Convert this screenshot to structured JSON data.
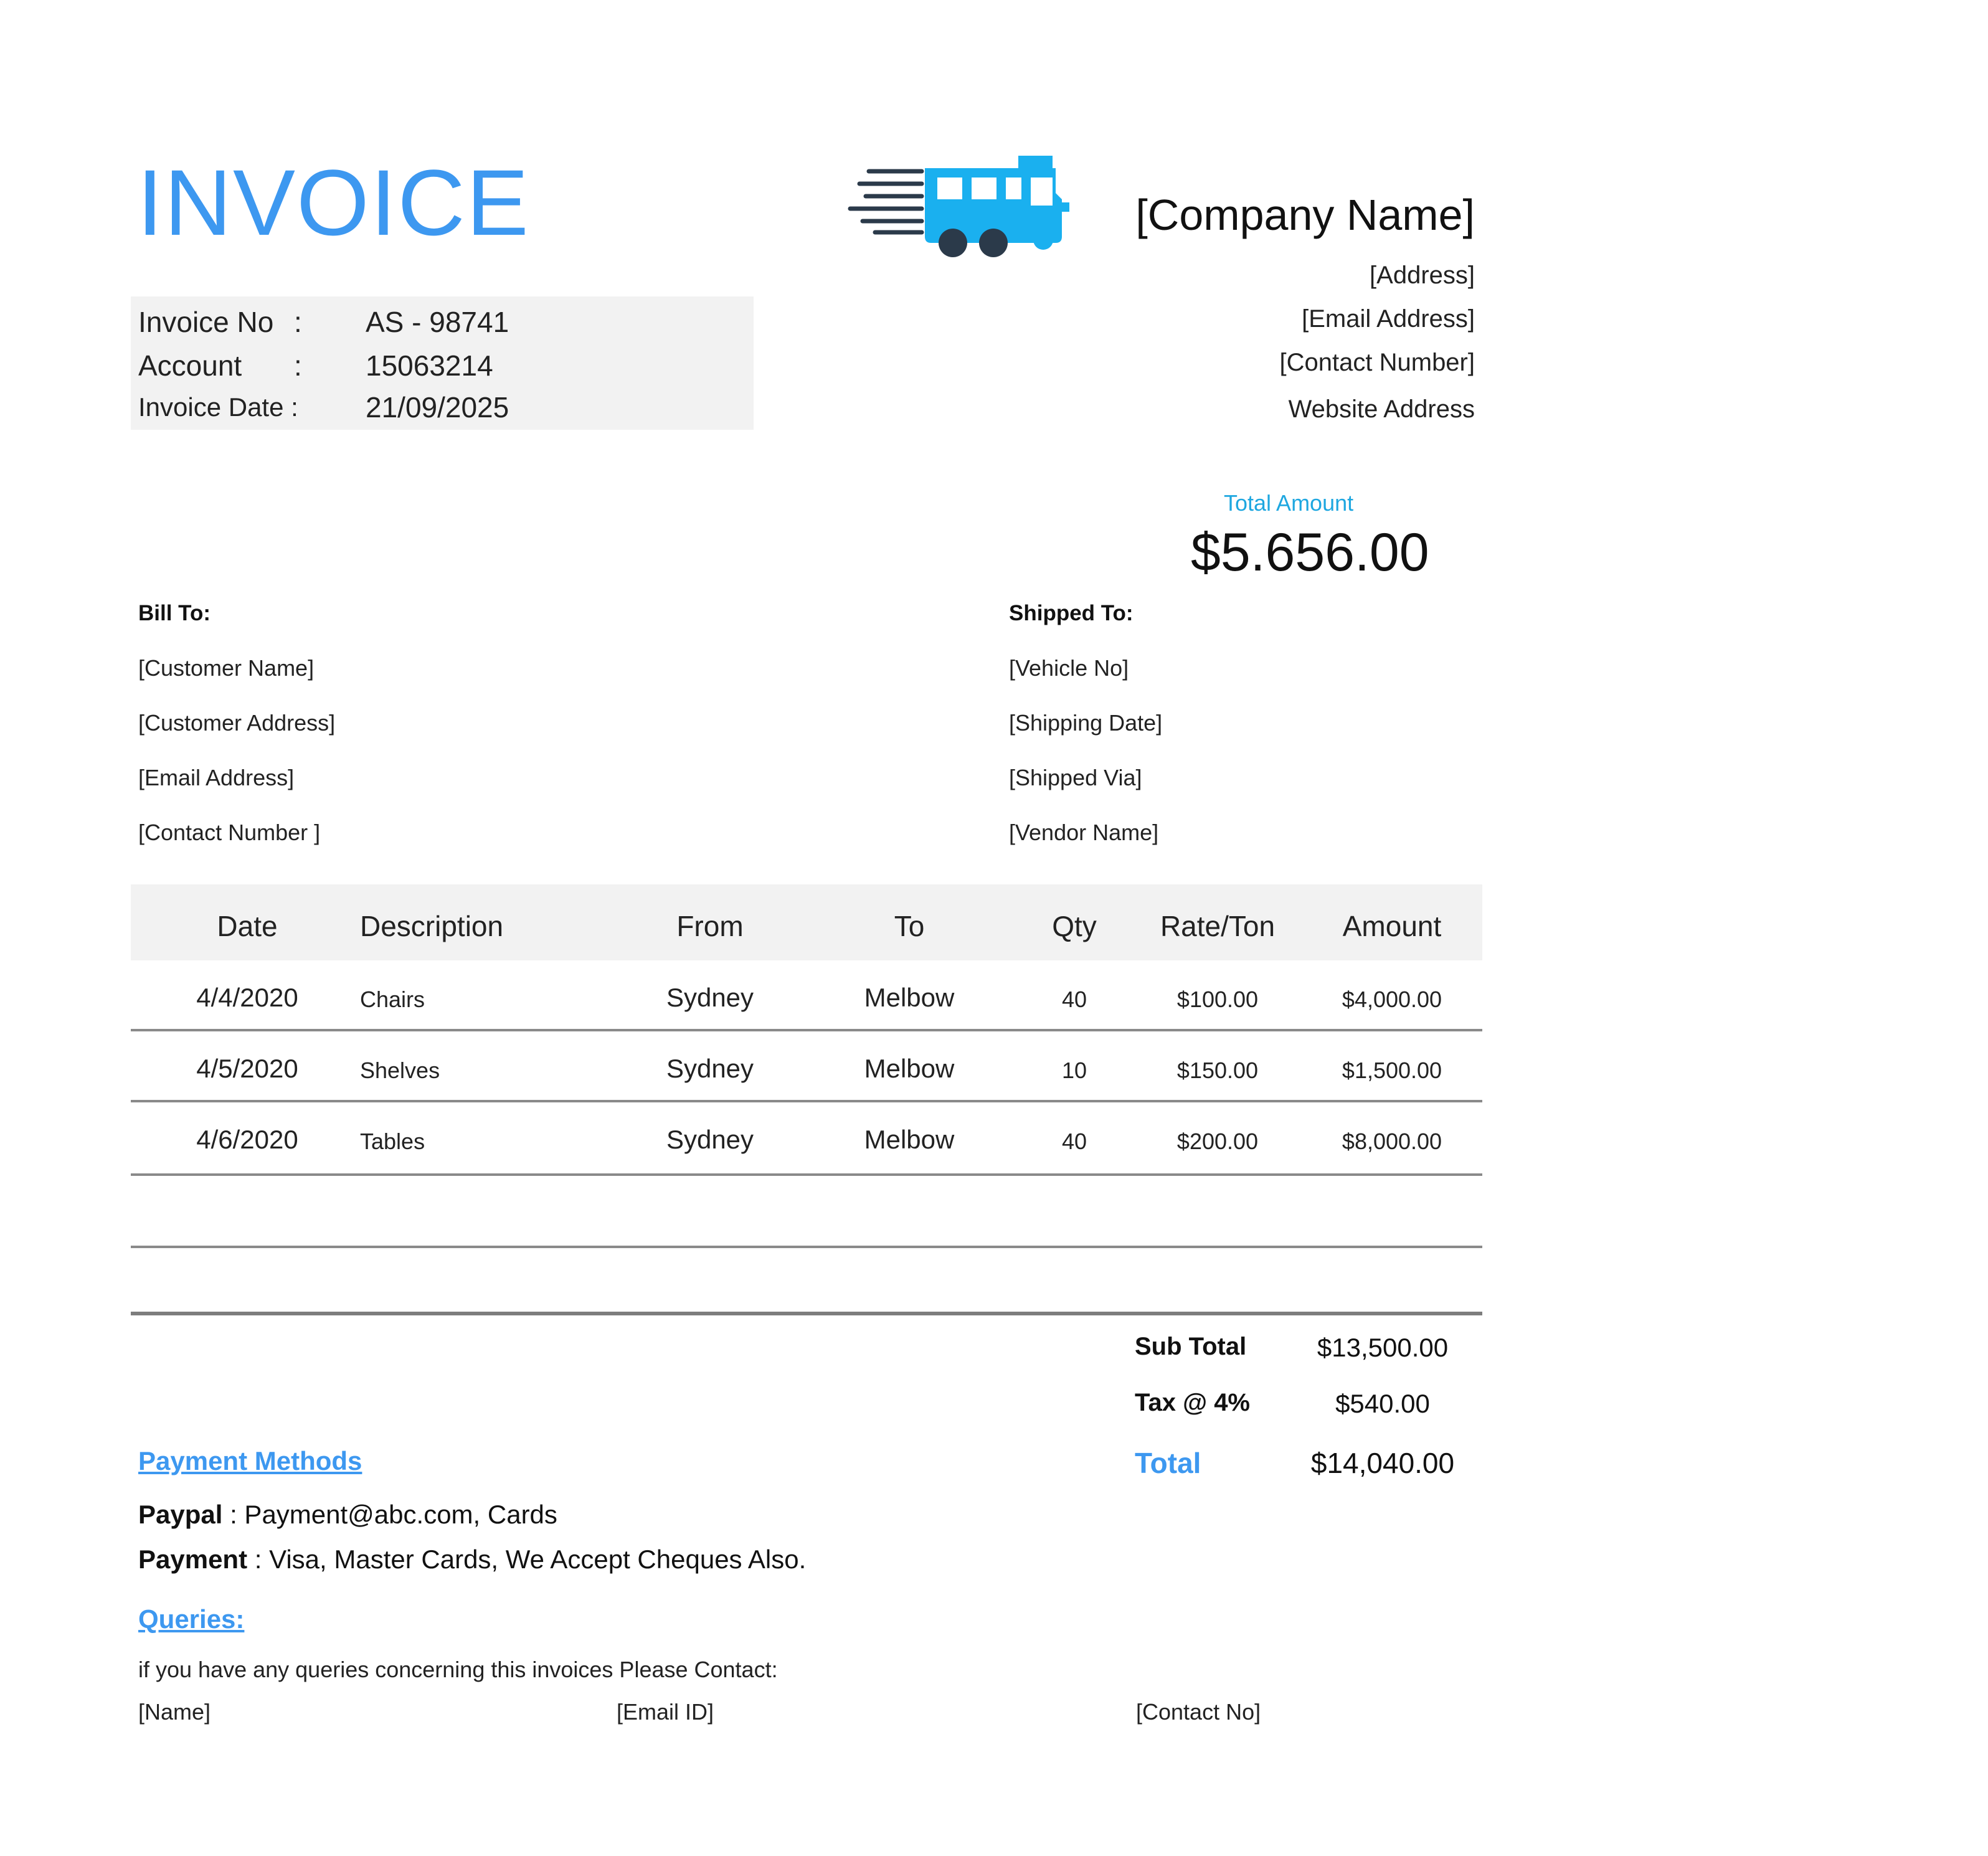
{
  "header": {
    "title": "INVOICE",
    "meta": {
      "invoice_no_label": "Invoice No",
      "invoice_no": "AS - 98741",
      "account_label": "Account",
      "account": "15063214",
      "invoice_date_label": "Invoice Date :",
      "invoice_date": "21/09/2025",
      "colon": ":"
    },
    "logo_icon": "truck-icon",
    "company": {
      "name": "[Company Name]",
      "address": "[Address]",
      "email": "[Email Address]",
      "contact": "[Contact Number]",
      "website": "Website Address"
    },
    "total_label": "Total Amount",
    "total_amount": "$5.656.00"
  },
  "bill_to": {
    "heading": "Bill To:",
    "customer_name": "[Customer Name]",
    "customer_address": "[Customer Address]",
    "email": "[Email Address]",
    "contact": "[Contact Number ]"
  },
  "shipped_to": {
    "heading": "Shipped To:",
    "vehicle_no": "[Vehicle No]",
    "shipping_date": "[Shipping Date]",
    "shipped_via": "[Shipped Via]",
    "vendor_name": "[Vendor Name]"
  },
  "table": {
    "columns": [
      "Date",
      "Description",
      "From",
      "To",
      "Qty",
      "Rate/Ton",
      "Amount"
    ],
    "rows": [
      {
        "date": "4/4/2020",
        "description": "Chairs",
        "from": "Sydney",
        "to": "Melbow",
        "qty": "40",
        "rate": "$100.00",
        "amount": "$4,000.00"
      },
      {
        "date": "4/5/2020",
        "description": "Shelves",
        "from": "Sydney",
        "to": "Melbow",
        "qty": "10",
        "rate": "$150.00",
        "amount": "$1,500.00"
      },
      {
        "date": "4/6/2020",
        "description": "Tables",
        "from": "Sydney",
        "to": "Melbow",
        "qty": "40",
        "rate": "$200.00",
        "amount": "$8,000.00"
      }
    ]
  },
  "summary": {
    "subtotal_label": "Sub Total",
    "subtotal": "$13,500.00",
    "tax_label": "Tax @ 4%",
    "tax": "$540.00",
    "total_label": "Total",
    "total": "$14,040.00"
  },
  "payment": {
    "heading": "Payment Methods",
    "paypal_label": "Paypal",
    "paypal_value": " : Payment@abc.com, Cards",
    "payment_label": "Payment",
    "payment_value": " : Visa, Master Cards, We Accept Cheques Also."
  },
  "queries": {
    "heading": "Queries:",
    "text": "if you have any queries concerning this invoices Please Contact:",
    "name": "[Name]",
    "email": "[Email ID]",
    "contact": "[Contact No]"
  },
  "colors": {
    "accent": "#3d98f0",
    "logo": "#1ab0ef",
    "logo_dark": "#2b3a4a",
    "panel": "#f2f2f2"
  }
}
